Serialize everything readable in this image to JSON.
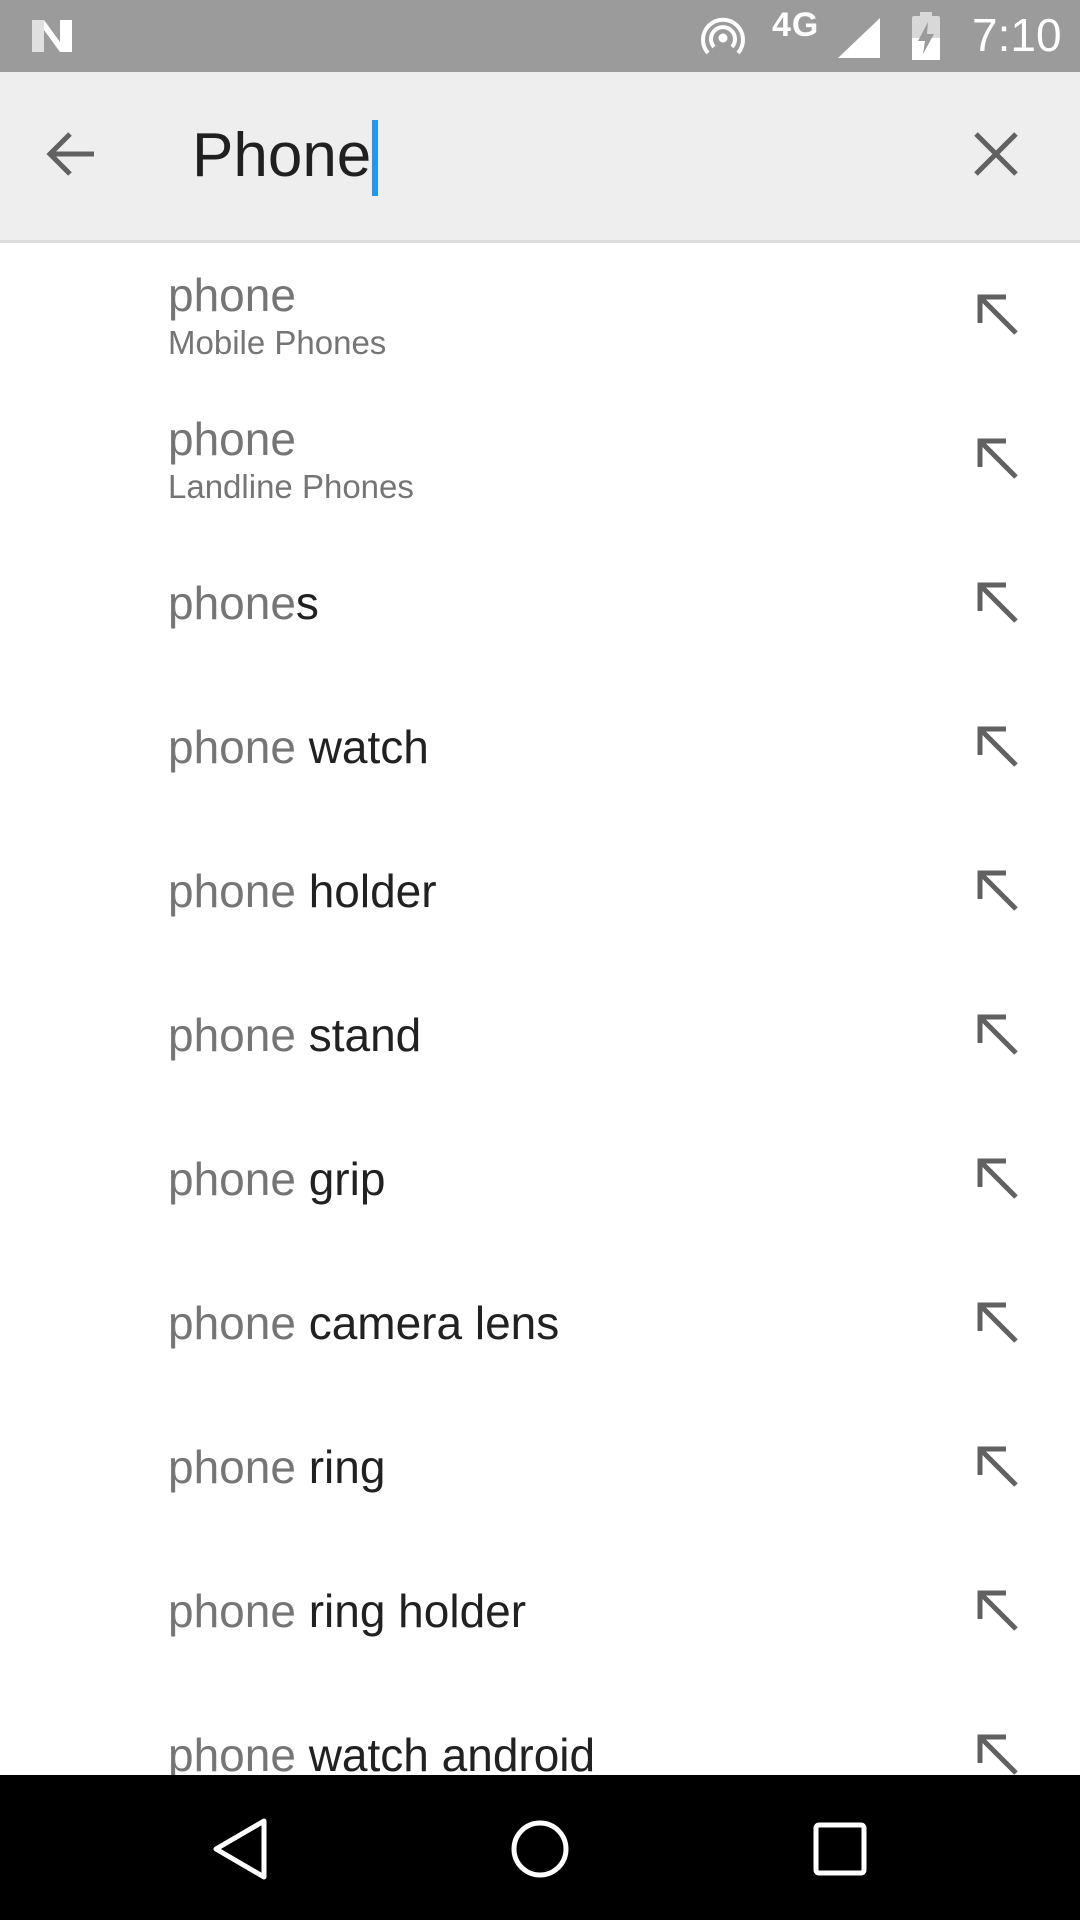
{
  "status_bar": {
    "network_type": "4G",
    "time": "7:10",
    "icons": [
      "n-logo-icon",
      "hotspot-icon",
      "signal-icon",
      "battery-charging-icon"
    ]
  },
  "search": {
    "query": "Phone",
    "icons": [
      "arrow-back-icon",
      "close-icon"
    ]
  },
  "suggestions": [
    {
      "prefix": "phone",
      "suffix": "",
      "subtitle": "Mobile Phones"
    },
    {
      "prefix": "phone",
      "suffix": "",
      "subtitle": "Landline Phones"
    },
    {
      "prefix": "phone",
      "suffix": "s",
      "subtitle": ""
    },
    {
      "prefix": "phone",
      "suffix": " watch",
      "subtitle": ""
    },
    {
      "prefix": "phone",
      "suffix": " holder",
      "subtitle": ""
    },
    {
      "prefix": "phone",
      "suffix": " stand",
      "subtitle": ""
    },
    {
      "prefix": "phone",
      "suffix": " grip",
      "subtitle": ""
    },
    {
      "prefix": "phone",
      "suffix": " camera lens",
      "subtitle": ""
    },
    {
      "prefix": "phone",
      "suffix": " ring",
      "subtitle": ""
    },
    {
      "prefix": "phone",
      "suffix": " ring holder",
      "subtitle": ""
    },
    {
      "prefix": "phone",
      "suffix": " watch android",
      "subtitle": ""
    }
  ],
  "suggestion_fill_icon": "arrow-up-left-icon",
  "nav_bar": {
    "icons": [
      "nav-back-icon",
      "nav-home-icon",
      "nav-recents-icon"
    ]
  },
  "colors": {
    "status_bar": "#9b9b9b",
    "toolbar": "#eeeeee",
    "caret": "#2196f3",
    "prefix_text": "#757575",
    "suffix_text": "#212121"
  }
}
